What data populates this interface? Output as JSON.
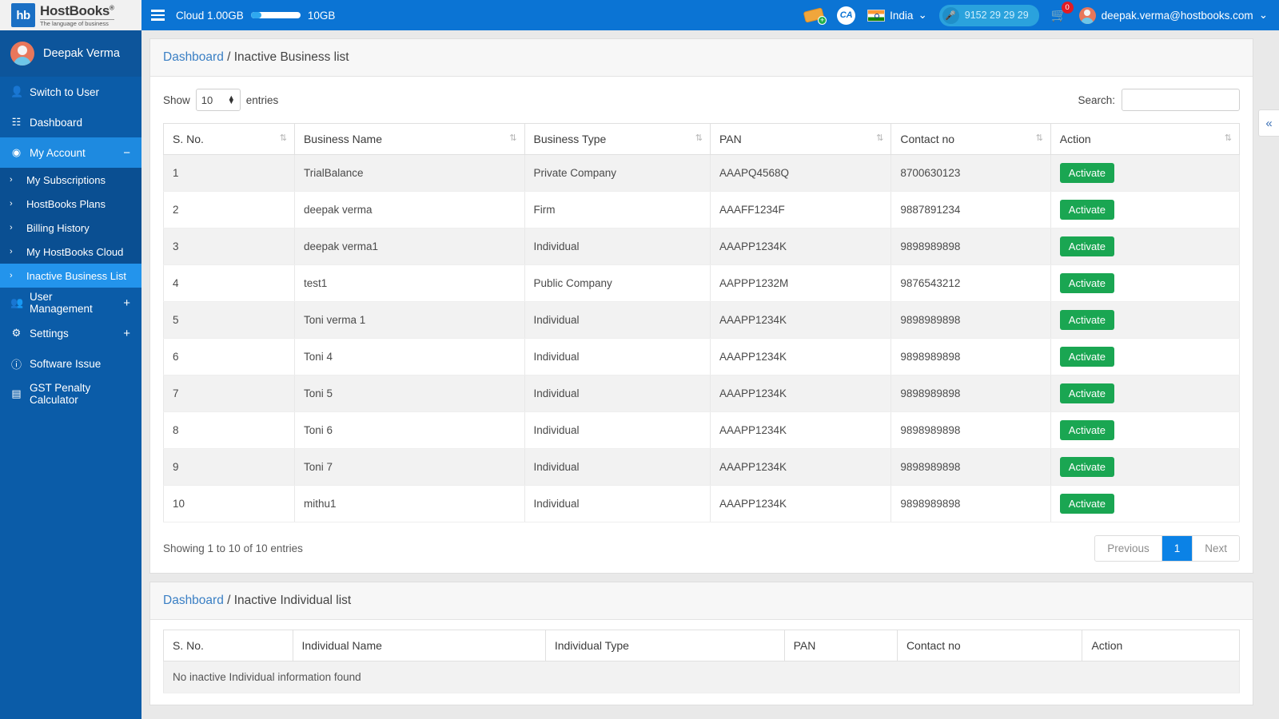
{
  "brand": {
    "mark": "hb",
    "name": "HostBooks",
    "reg": "®",
    "tagline": "The language of business"
  },
  "sidebar": {
    "profile_name": "Deepak Verma",
    "items": [
      {
        "label": "Switch to User",
        "icon": "user-icon",
        "type": "item"
      },
      {
        "label": "Dashboard",
        "icon": "dashboard-icon",
        "type": "item"
      },
      {
        "label": "My Account",
        "icon": "account-icon",
        "type": "parent",
        "state": "expanded",
        "toggle": "−"
      }
    ],
    "sub_items": [
      {
        "label": "My Subscriptions",
        "active": false
      },
      {
        "label": "HostBooks Plans",
        "active": false
      },
      {
        "label": "Billing History",
        "active": false
      },
      {
        "label": "My HostBooks Cloud",
        "active": false
      },
      {
        "label": "Inactive Business List",
        "active": true
      }
    ],
    "items_bottom": [
      {
        "label": "User Management",
        "icon": "users-icon",
        "toggle": "+"
      },
      {
        "label": "Settings",
        "icon": "gear-icon",
        "toggle": "+"
      },
      {
        "label": "Software Issue",
        "icon": "info-icon",
        "toggle": ""
      },
      {
        "label": "GST Penalty Calculator",
        "icon": "calculator-icon",
        "toggle": ""
      }
    ]
  },
  "topbar": {
    "cloud_label": "Cloud 1.00GB",
    "cloud_max": "10GB",
    "cloud_used_percent": 10,
    "country": "India",
    "phone": "9152 29 29 29",
    "cart_count": "0",
    "user_email": "deepak.verma@hostbooks.com",
    "chevron": "⌄",
    "ca_label": "CA"
  },
  "business_card": {
    "breadcrumb_link": "Dashboard",
    "breadcrumb_sep": "/",
    "breadcrumb_current": "Inactive Business list",
    "show_label": "Show",
    "entries_value": "10",
    "entries_label": "entries",
    "search_label": "Search:",
    "search_value": "",
    "search_placeholder": "",
    "columns": [
      "S. No.",
      "Business Name",
      "Business Type",
      "PAN",
      "Contact no",
      "Action"
    ],
    "sortable": [
      true,
      true,
      true,
      true,
      true,
      true
    ],
    "rows": [
      {
        "sno": "1",
        "name": "TrialBalance",
        "type": "Private Company",
        "pan": "AAAPQ4568Q",
        "contact": "8700630123",
        "action": "Activate"
      },
      {
        "sno": "2",
        "name": "deepak verma",
        "type": "Firm",
        "pan": "AAAFF1234F",
        "contact": "9887891234",
        "action": "Activate"
      },
      {
        "sno": "3",
        "name": "deepak verma1",
        "type": "Individual",
        "pan": "AAAPP1234K",
        "contact": "9898989898",
        "action": "Activate"
      },
      {
        "sno": "4",
        "name": "test1",
        "type": "Public Company",
        "pan": "AAPPP1232M",
        "contact": "9876543212",
        "action": "Activate"
      },
      {
        "sno": "5",
        "name": "Toni verma 1",
        "type": "Individual",
        "pan": "AAAPP1234K",
        "contact": "9898989898",
        "action": "Activate"
      },
      {
        "sno": "6",
        "name": "Toni 4",
        "type": "Individual",
        "pan": "AAAPP1234K",
        "contact": "9898989898",
        "action": "Activate"
      },
      {
        "sno": "7",
        "name": "Toni 5",
        "type": "Individual",
        "pan": "AAAPP1234K",
        "contact": "9898989898",
        "action": "Activate"
      },
      {
        "sno": "8",
        "name": "Toni 6",
        "type": "Individual",
        "pan": "AAAPP1234K",
        "contact": "9898989898",
        "action": "Activate"
      },
      {
        "sno": "9",
        "name": "Toni 7",
        "type": "Individual",
        "pan": "AAAPP1234K",
        "contact": "9898989898",
        "action": "Activate"
      },
      {
        "sno": "10",
        "name": "mithu1",
        "type": "Individual",
        "pan": "AAAPP1234K",
        "contact": "9898989898",
        "action": "Activate"
      }
    ],
    "showing_text": "Showing 1 to 10 of 10 entries",
    "pagination": {
      "previous": "Previous",
      "pages": [
        "1"
      ],
      "current": "1",
      "next": "Next"
    }
  },
  "individual_card": {
    "breadcrumb_link": "Dashboard",
    "breadcrumb_sep": "/",
    "breadcrumb_current": "Inactive Individual list",
    "columns": [
      "S. No.",
      "Individual Name",
      "Individual Type",
      "PAN",
      "Contact no",
      "Action"
    ],
    "empty_message": "No inactive Individual information found"
  },
  "collapse_button": {
    "glyph": "«"
  },
  "colors": {
    "topbar_blue": "#0b74d4",
    "sidebar_blue": "#0b5ca8",
    "sidebar_active": "#2394ec",
    "activate_green": "#1aa652",
    "pager_active": "#0b82e6",
    "link_blue": "#3a7fc4",
    "badge_red": "#e01b24"
  }
}
